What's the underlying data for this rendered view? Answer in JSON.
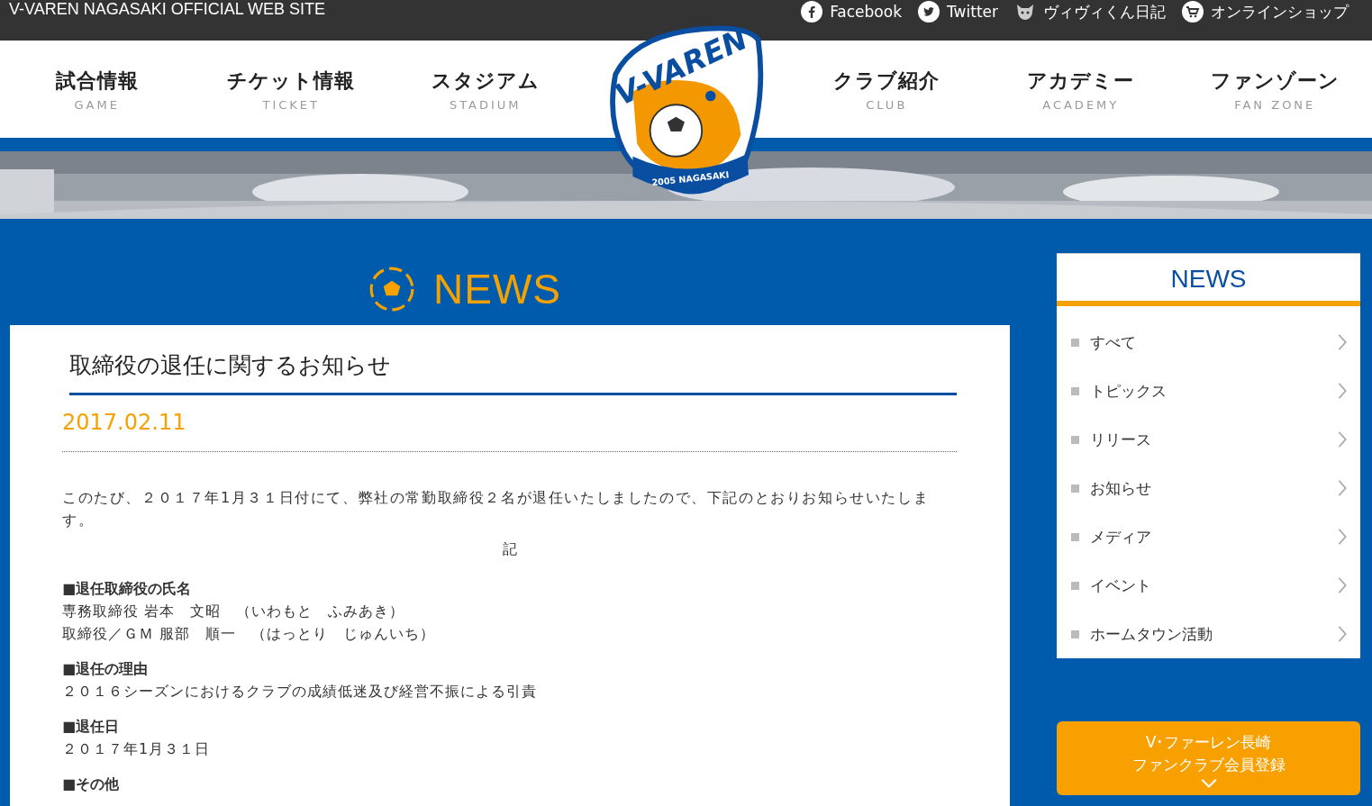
{
  "top_bar": {
    "site_title": "V-VAREN NAGASAKI OFFICIAL WEB SITE",
    "links": [
      {
        "label": "Facebook",
        "kind": "facebook"
      },
      {
        "label": "Twitter",
        "kind": "twitter"
      },
      {
        "label": "ヴィヴィくん日記",
        "kind": "mascot"
      },
      {
        "label": "オンラインショップ",
        "kind": "cart"
      }
    ]
  },
  "logo": {
    "name": "V-VAREN",
    "year": "2005 NAGASAKI"
  },
  "nav": {
    "left": [
      {
        "label": "試合情報",
        "sub": "GAME"
      },
      {
        "label": "チケット情報",
        "sub": "TICKET"
      },
      {
        "label": "スタジアム",
        "sub": "STADIUM"
      }
    ],
    "right": [
      {
        "label": "クラブ紹介",
        "sub": "CLUB"
      },
      {
        "label": "アカデミー",
        "sub": "ACADEMY"
      },
      {
        "label": "ファンゾーン",
        "sub": "FAN ZONE"
      }
    ]
  },
  "section_heading": "NEWS",
  "article": {
    "title": "取締役の退任に関するお知らせ",
    "date": "2017.02.11",
    "intro": "このたび、２０１７年1月３１日付にて、弊社の常勤取締役２名が退任いたしましたので、下記のとおりお知らせいたします。",
    "ki": "記",
    "sections": [
      {
        "heading": "■退任取締役の氏名",
        "lines": [
          "専務取締役 岩本　文昭　（いわもと　ふみあき）",
          "取締役／ＧＭ 服部　順一　（はっとり　じゅんいち）"
        ]
      },
      {
        "heading": "■退任の理由",
        "lines": [
          "２０１６シーズンにおけるクラブの成績低迷及び経営不振による引責"
        ]
      },
      {
        "heading": "■退任日",
        "lines": [
          "２０１７年1月３１日"
        ]
      },
      {
        "heading": "■その他"
      }
    ]
  },
  "sidebar": {
    "title": "NEWS",
    "items": [
      "すべて",
      "トピックス",
      "リリース",
      "お知らせ",
      "メディア",
      "イベント",
      "ホームタウン活動"
    ]
  },
  "fanclub_button": {
    "lines": [
      "V･ファーレン長崎",
      "ファンクラブ会員登録"
    ]
  }
}
